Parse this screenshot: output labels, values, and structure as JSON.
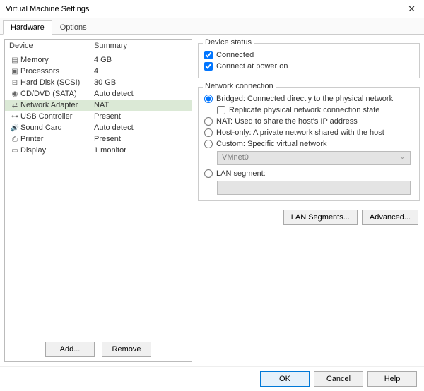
{
  "window": {
    "title": "Virtual Machine Settings"
  },
  "tabs": {
    "hardware": "Hardware",
    "options": "Options"
  },
  "headers": {
    "device": "Device",
    "summary": "Summary"
  },
  "devices": {
    "memory": {
      "label": "Memory",
      "summary": "4 GB"
    },
    "processors": {
      "label": "Processors",
      "summary": "4"
    },
    "harddisk": {
      "label": "Hard Disk (SCSI)",
      "summary": "30 GB"
    },
    "cddvd": {
      "label": "CD/DVD (SATA)",
      "summary": "Auto detect"
    },
    "network": {
      "label": "Network Adapter",
      "summary": "NAT"
    },
    "usb": {
      "label": "USB Controller",
      "summary": "Present"
    },
    "sound": {
      "label": "Sound Card",
      "summary": "Auto detect"
    },
    "printer": {
      "label": "Printer",
      "summary": "Present"
    },
    "display": {
      "label": "Display",
      "summary": "1 monitor"
    }
  },
  "left_buttons": {
    "add": "Add...",
    "remove": "Remove"
  },
  "device_status": {
    "legend": "Device status",
    "connected": "Connected",
    "connect_at_power_on": "Connect at power on"
  },
  "network_connection": {
    "legend": "Network connection",
    "bridged": "Bridged: Connected directly to the physical network",
    "replicate": "Replicate physical network connection state",
    "nat": "NAT: Used to share the host's IP address",
    "hostonly": "Host-only: A private network shared with the host",
    "custom": "Custom: Specific virtual network",
    "custom_value": "VMnet0",
    "lan_segment": "LAN segment:",
    "lan_segment_value": ""
  },
  "network_buttons": {
    "lan_segments": "LAN Segments...",
    "advanced": "Advanced..."
  },
  "footer": {
    "ok": "OK",
    "cancel": "Cancel",
    "help": "Help"
  }
}
